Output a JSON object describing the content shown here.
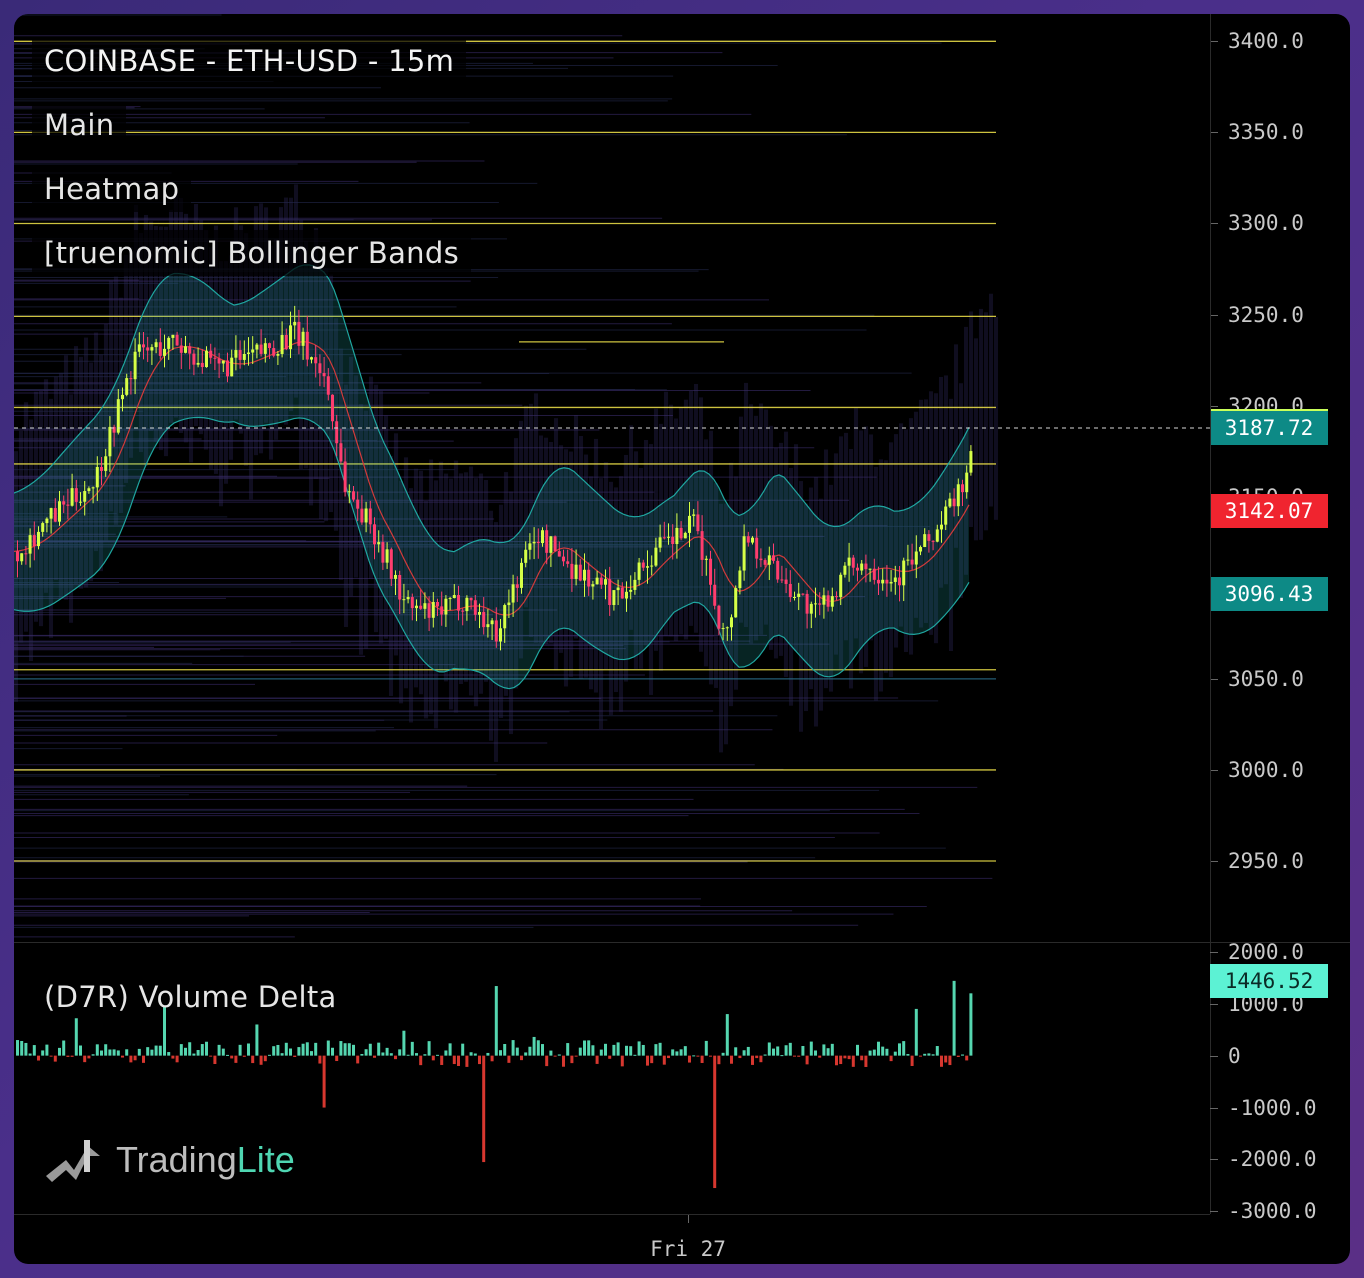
{
  "legend": {
    "title": "COINBASE - ETH-USD - 15m",
    "items": [
      "Main",
      "Heatmap",
      "[truenomic] Bollinger Bands"
    ],
    "volume_delta": "(D7R) Volume Delta"
  },
  "price_axis": {
    "labels": [
      "3400.0",
      "3350.0",
      "3300.0",
      "3250.0",
      "3200.0",
      "3150.0",
      "3050.0",
      "3000.0",
      "2950.0"
    ],
    "min": 2905,
    "max": 3415
  },
  "price_tags": [
    {
      "label": "3187.72",
      "value": 3187.72,
      "color": "#0d8a86",
      "name": "current-price-tag"
    },
    {
      "label": "3142.07",
      "value": 3142.07,
      "color": "#f0242f",
      "name": "bb-upper-tag"
    },
    {
      "label": "3096.43",
      "value": 3096.43,
      "color": "#0d8a86",
      "name": "bb-basis-tag"
    }
  ],
  "current_price_marker": {
    "value": 3197,
    "color": "#c9ff5a"
  },
  "volume_axis": {
    "labels": [
      "2000.0",
      "1000.0",
      "0",
      "-1000.0",
      "-2000.0",
      "-3000.0"
    ],
    "min": -3050,
    "max": 2150,
    "tag": {
      "label": "1446.52",
      "value": 1446.52,
      "color": "#5cf2d4"
    }
  },
  "time_axis": {
    "label": "Fri 27"
  },
  "branding": {
    "name_a": "Trading",
    "name_b": "Lite"
  },
  "colors": {
    "up": "#d6ff47",
    "down": "#ff3d6e",
    "band": "#1fa6a0",
    "basis": "#d23a3a",
    "delta_pos": "#55d6b0",
    "delta_neg": "#d7372f",
    "level": "#f1e44a"
  },
  "chart_data": {
    "type": "candlestick",
    "ohlc_series": "ETH-USD 15m",
    "level_lines": [
      3400,
      3350,
      3300,
      3249,
      3235,
      3199,
      3168,
      3055,
      3050,
      3000,
      2950
    ],
    "price_points": [
      [
        0,
        3120
      ],
      [
        40,
        3140
      ],
      [
        80,
        3160
      ],
      [
        120,
        3228
      ],
      [
        160,
        3235
      ],
      [
        200,
        3220
      ],
      [
        240,
        3228
      ],
      [
        280,
        3240
      ],
      [
        310,
        3215
      ],
      [
        330,
        3155
      ],
      [
        360,
        3130
      ],
      [
        390,
        3090
      ],
      [
        420,
        3085
      ],
      [
        450,
        3095
      ],
      [
        480,
        3075
      ],
      [
        520,
        3130
      ],
      [
        560,
        3110
      ],
      [
        600,
        3095
      ],
      [
        640,
        3120
      ],
      [
        680,
        3135
      ],
      [
        710,
        3070
      ],
      [
        730,
        3130
      ],
      [
        760,
        3110
      ],
      [
        800,
        3085
      ],
      [
        840,
        3115
      ],
      [
        880,
        3105
      ],
      [
        920,
        3130
      ],
      [
        950,
        3160
      ],
      [
        970,
        3192
      ]
    ],
    "delta_points": [
      [
        0,
        300
      ],
      [
        60,
        720
      ],
      [
        150,
        940
      ],
      [
        240,
        600
      ],
      [
        310,
        -1000
      ],
      [
        390,
        480
      ],
      [
        470,
        -2050
      ],
      [
        480,
        1340
      ],
      [
        520,
        360
      ],
      [
        700,
        -2550
      ],
      [
        710,
        800
      ],
      [
        900,
        900
      ],
      [
        940,
        1440
      ],
      [
        955,
        1200
      ]
    ]
  }
}
